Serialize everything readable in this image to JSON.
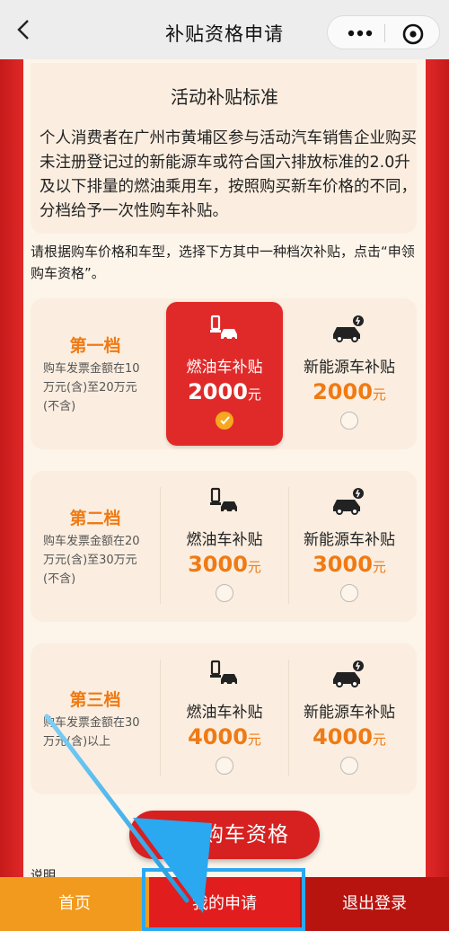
{
  "header": {
    "title": "补贴资格申请",
    "back_icon": "chevron-left-icon",
    "more_icon": "ellipsis-icon",
    "close_icon": "target-close-icon"
  },
  "standard": {
    "title": "活动补贴标准",
    "text": "个人消费者在广州市黄埔区参与活动汽车销售企业购买未注册登记过的新能源车或符合国六排放标准的2.0升及以下排量的燃油乘用车，按照购买新车价格的不同，分档给予一次性购车补贴。"
  },
  "instruction": "请根据购车价格和车型，选择下方其中一种档次补贴，点击“申领购车资格”。",
  "tiers": [
    {
      "name": "第一档",
      "desc": "购车发票金额在10万元(含)至20万元(不含)",
      "options": [
        {
          "name": "燃油车补贴",
          "amount": "2000",
          "unit": "元",
          "selected": true,
          "icon": "gas-car-icon"
        },
        {
          "name": "新能源车补贴",
          "amount": "2000",
          "unit": "元",
          "selected": false,
          "icon": "electric-car-icon"
        }
      ]
    },
    {
      "name": "第二档",
      "desc": "购车发票金额在20万元(含)至30万元(不含)",
      "options": [
        {
          "name": "燃油车补贴",
          "amount": "3000",
          "unit": "元",
          "selected": false,
          "icon": "gas-car-icon"
        },
        {
          "name": "新能源车补贴",
          "amount": "3000",
          "unit": "元",
          "selected": false,
          "icon": "electric-car-icon"
        }
      ]
    },
    {
      "name": "第三档",
      "desc": "购车发票金额在30万元(含)以上",
      "options": [
        {
          "name": "燃油车补贴",
          "amount": "4000",
          "unit": "元",
          "selected": false,
          "icon": "gas-car-icon"
        },
        {
          "name": "新能源车补贴",
          "amount": "4000",
          "unit": "元",
          "selected": false,
          "icon": "electric-car-icon"
        }
      ]
    }
  ],
  "apply_button": "申领购车资格",
  "notes_heading": "说明",
  "tabbar": {
    "home": "首页",
    "my_application": "我的申请",
    "logout": "退出登录"
  },
  "colors": {
    "brand_red": "#e21d1d",
    "accent_orange": "#f07a14",
    "highlight_blue": "#2aa8f0"
  }
}
